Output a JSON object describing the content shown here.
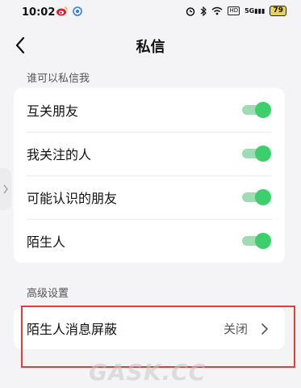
{
  "status_bar": {
    "time": "10:02",
    "signal": "5G",
    "battery": "79",
    "hd": "HD"
  },
  "nav": {
    "title": "私信"
  },
  "who_can_message": {
    "section_label": "谁可以私信我",
    "items": [
      {
        "label": "互关朋友",
        "enabled": true
      },
      {
        "label": "我关注的人",
        "enabled": true
      },
      {
        "label": "可能认识的朋友",
        "enabled": true
      },
      {
        "label": "陌生人",
        "enabled": true
      }
    ]
  },
  "advanced": {
    "section_label": "高级设置",
    "stranger_block": {
      "label": "陌生人消息屏蔽",
      "value": "关闭"
    }
  },
  "watermark": "GASK.CC",
  "colors": {
    "toggle_on": "#3ccf6c",
    "highlight": "#e23d3a",
    "battery": "#e8d35a"
  }
}
